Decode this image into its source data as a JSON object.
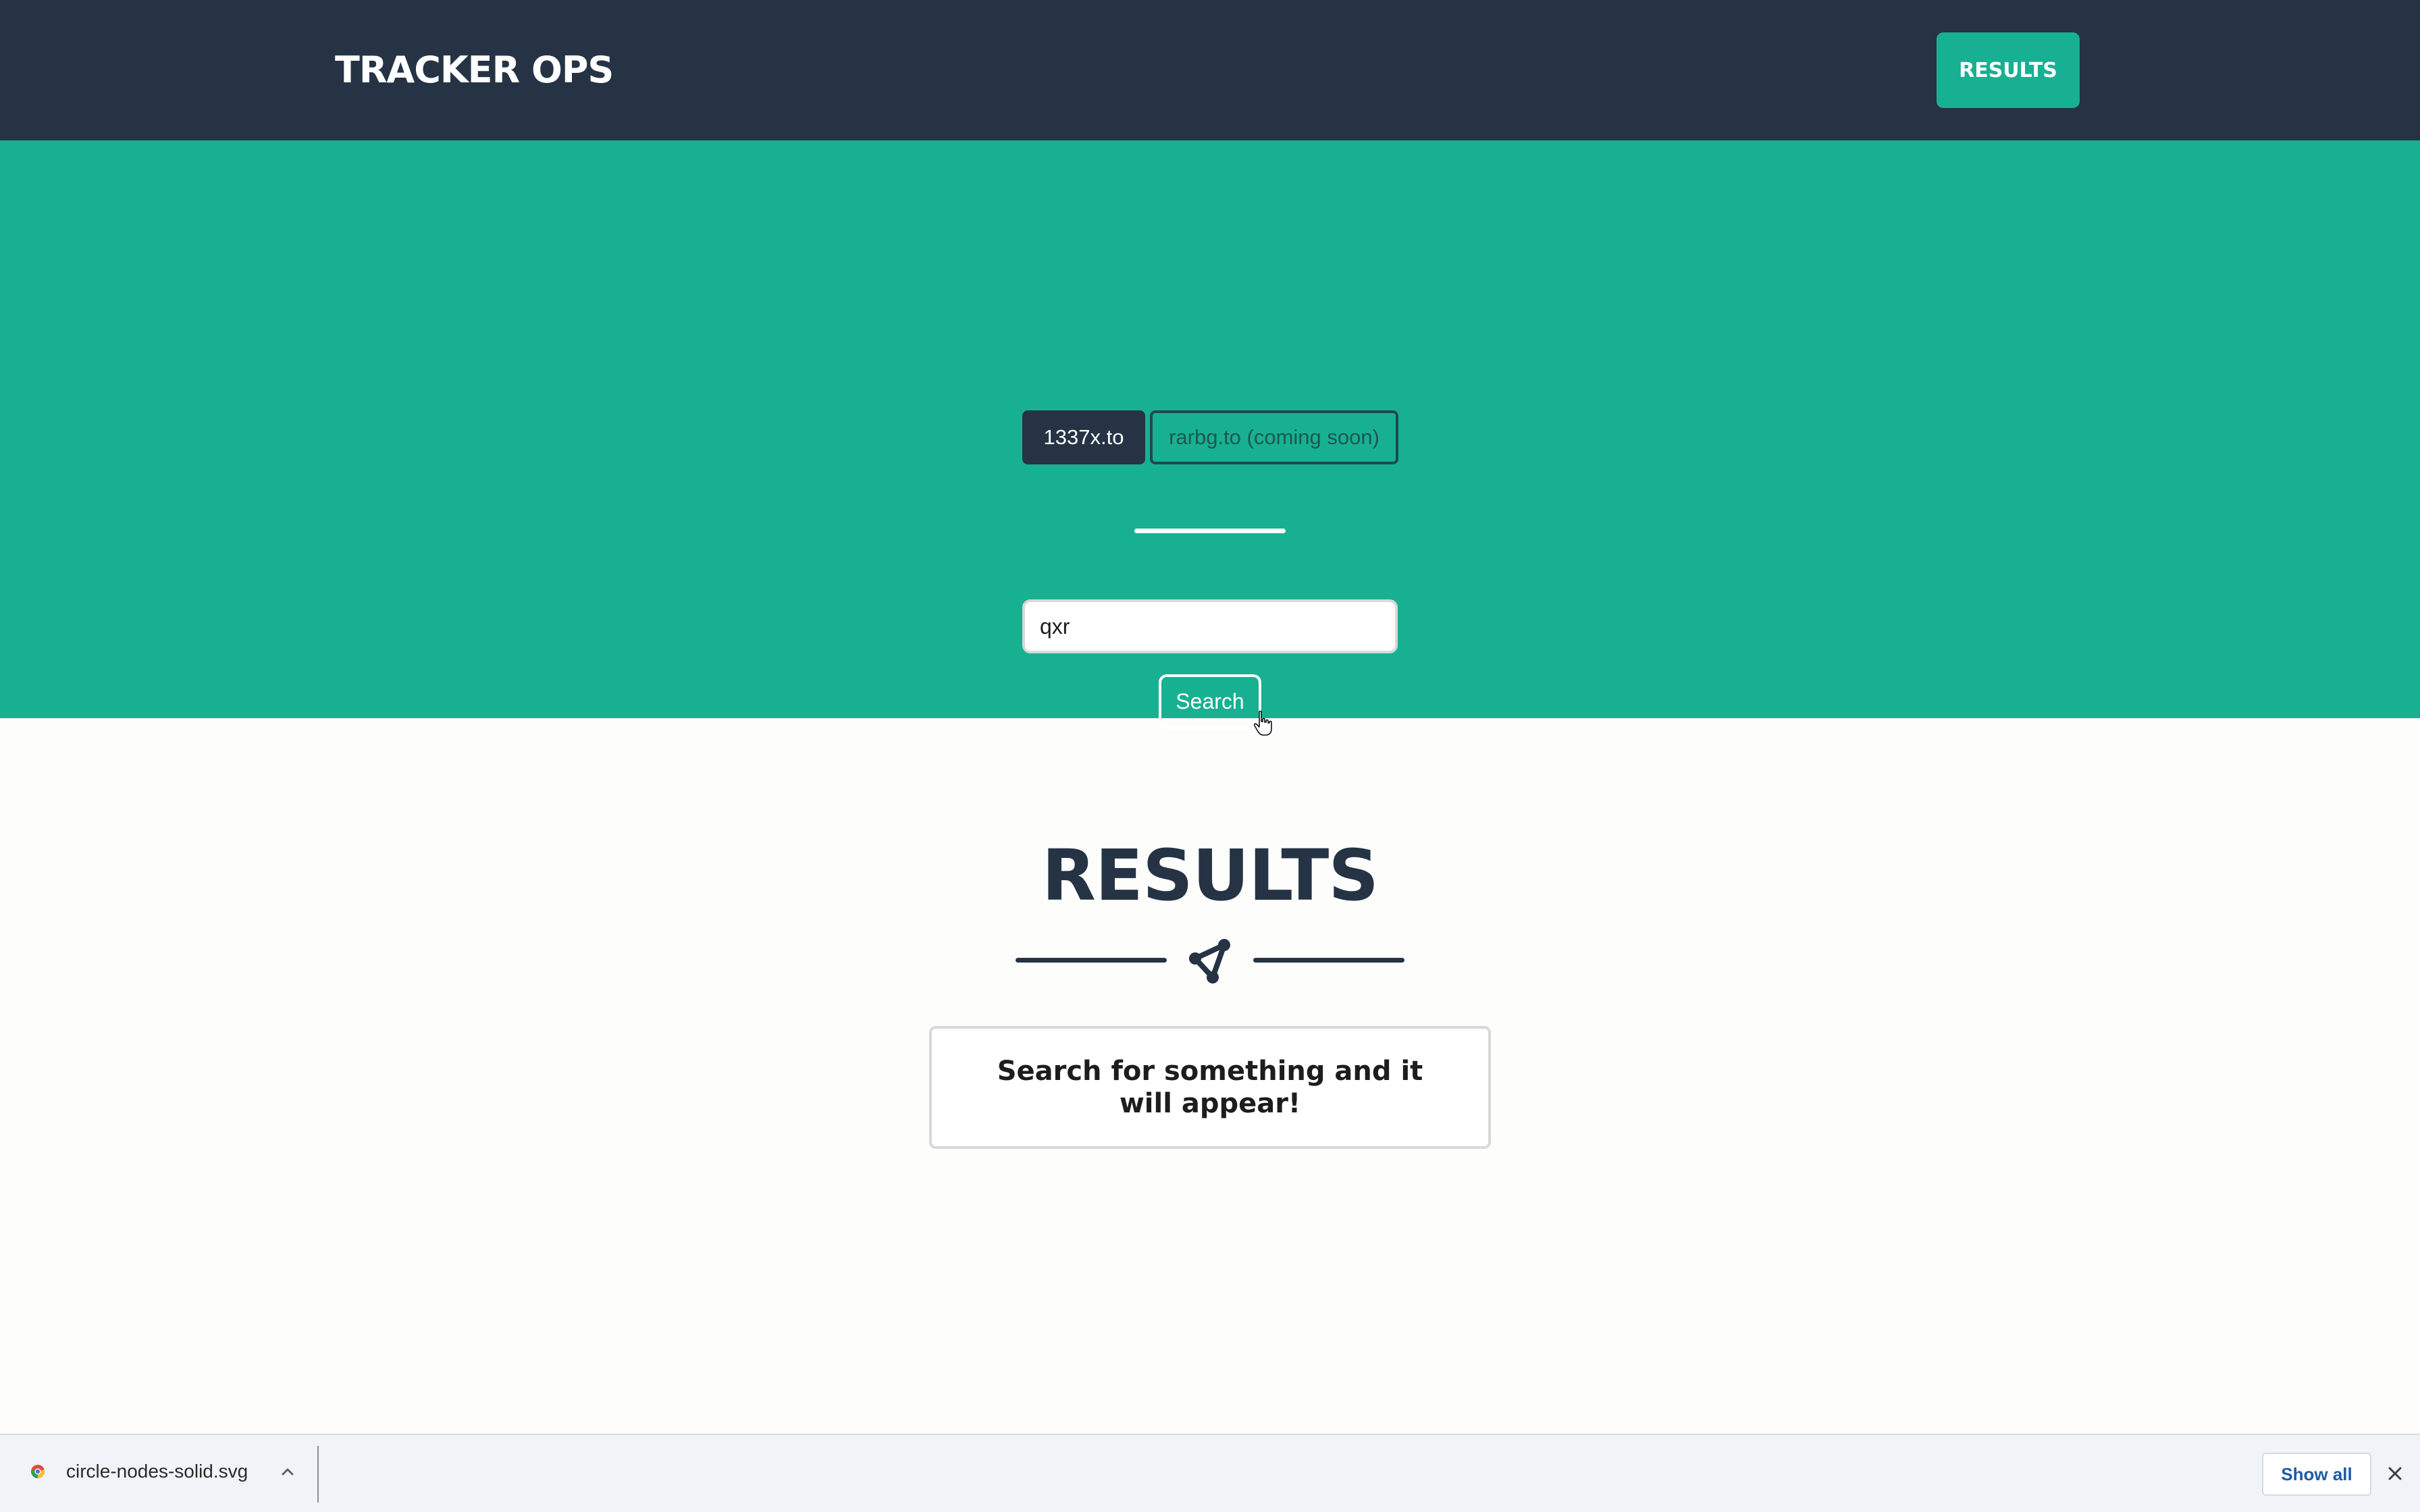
{
  "navbar": {
    "brand": "TRACKER OPS",
    "results_button": "RESULTS"
  },
  "hero": {
    "tabs": [
      {
        "label": "1337x.to",
        "active": true
      },
      {
        "label": "rarbg.to (coming soon)",
        "active": false
      }
    ],
    "search": {
      "value": "qxr",
      "button_label": "Search"
    }
  },
  "results": {
    "title": "RESULTS",
    "divider_icon": "circle-nodes-icon",
    "empty_message": "Search for something and it will appear!"
  },
  "download_bar": {
    "filename": "circle-nodes-solid.svg",
    "show_all": "Show all",
    "file_icon": "chrome-file-icon",
    "chevron_icon": "chevron-up-icon",
    "close_icon": "close-icon"
  },
  "colors": {
    "navbar": "#253345",
    "accent": "#17b191",
    "text_dark": "#253345",
    "link_blue": "#1f5ba6"
  }
}
